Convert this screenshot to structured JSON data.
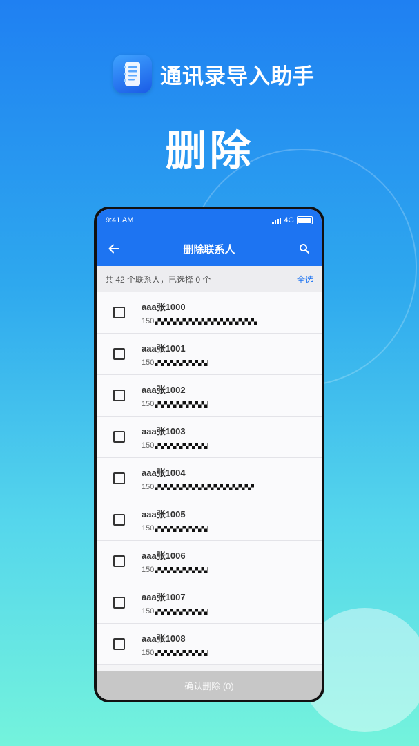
{
  "brand": {
    "app_name": "通讯录导入助手",
    "icon": "contacts-book-icon"
  },
  "hero": {
    "title": "删除"
  },
  "phone": {
    "status": {
      "time": "9:41 AM",
      "network": "4G"
    },
    "appbar": {
      "title": "删除联系人",
      "back_icon": "arrow-left-icon",
      "search_icon": "search-icon"
    },
    "summary": {
      "text": "共 42 个联系人，已选择 0 个",
      "select_all_label": "全选"
    },
    "contacts": [
      {
        "name": "aaa张1000",
        "phone_prefix": "150"
      },
      {
        "name": "aaa张1001",
        "phone_prefix": "150"
      },
      {
        "name": "aaa张1002",
        "phone_prefix": "150"
      },
      {
        "name": "aaa张1003",
        "phone_prefix": "150"
      },
      {
        "name": "aaa张1004",
        "phone_prefix": "150"
      },
      {
        "name": "aaa张1005",
        "phone_prefix": "150"
      },
      {
        "name": "aaa张1006",
        "phone_prefix": "150"
      },
      {
        "name": "aaa张1007",
        "phone_prefix": "150"
      },
      {
        "name": "aaa张1008",
        "phone_prefix": "150"
      }
    ],
    "footer": {
      "confirm_label": "确认删除 (0)"
    }
  },
  "colors": {
    "primary": "#1d74f2",
    "disabled_button": "#c7c7c7"
  }
}
